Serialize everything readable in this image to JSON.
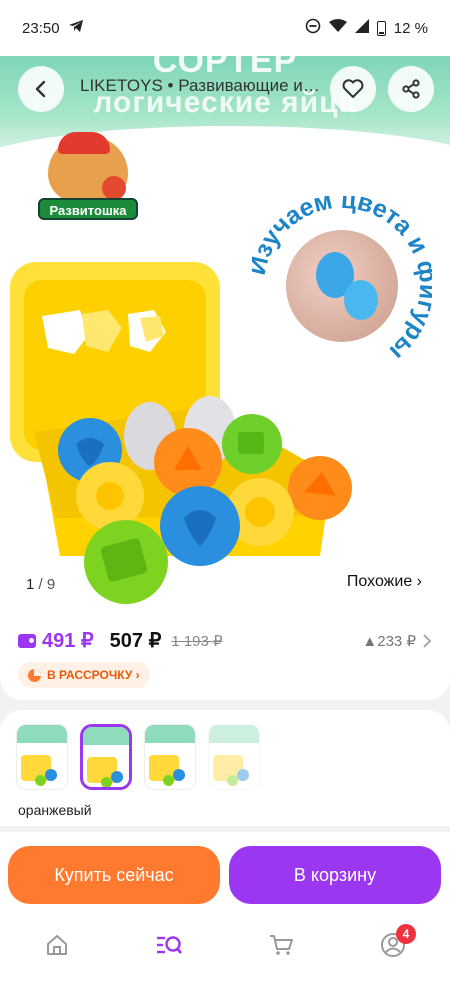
{
  "status_bar": {
    "time": "23:50",
    "battery": "12 %"
  },
  "header": {
    "title": "LIKETOYS • Развивающие игрушки"
  },
  "image": {
    "ad_title_1": "СОРТЕР",
    "ad_title_2": "логические яйца",
    "brand_tag": "Развитошка",
    "badge_text": "Изучаем цвета и фигуры",
    "current": "1",
    "total": "9",
    "similar_label": "Похожие ›"
  },
  "price": {
    "wallet_price": "491 ₽",
    "price": "507 ₽",
    "old_price": "1 193 ₽",
    "delta": "▲233 ₽",
    "installment_label": "В РАССРОЧКУ ›"
  },
  "variants": {
    "selected_label": "оранжевый",
    "items": [
      {
        "title": "СОРТЕР",
        "selected": false
      },
      {
        "title": "СОРТЕР",
        "selected": true
      },
      {
        "title": "СОРТЕР",
        "selected": false
      },
      {
        "title": "СОРТЕР",
        "selected": false
      }
    ]
  },
  "actions": {
    "buy_now": "Купить сейчас",
    "add_to_cart": "В корзину"
  },
  "nav": {
    "profile_badge": "4"
  },
  "colors": {
    "accent": "#9b37f0",
    "buy": "#ff7a2f",
    "badge": "#f0313f"
  }
}
